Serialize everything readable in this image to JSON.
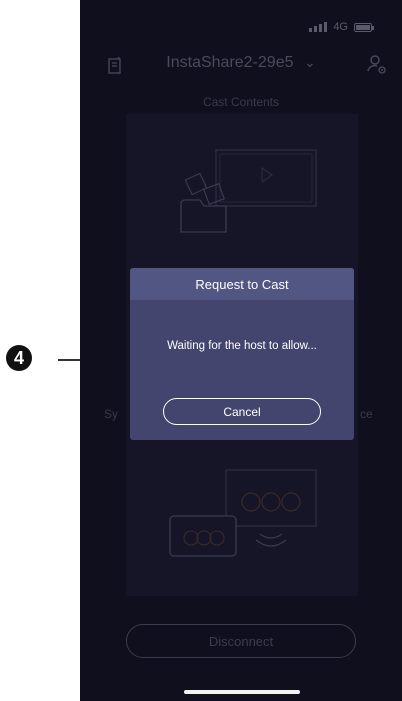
{
  "callout": {
    "number": "4"
  },
  "status_bar": {
    "network": "4G"
  },
  "header": {
    "title": "InstaShare2-29e5",
    "dropdown_icon": "chevron-down-icon"
  },
  "subtitle": "Cast Contents",
  "sync": {
    "left": "Sy",
    "right": "ce"
  },
  "disconnect_label": "Disconnect",
  "dialog": {
    "title": "Request to Cast",
    "message": "Waiting for the host to allow...",
    "cancel_label": "Cancel"
  },
  "colors": {
    "background": "#0f0f1d",
    "dialog": "#43456e",
    "dialog_header": "#525682",
    "muted_text": "#4a4a5c"
  }
}
